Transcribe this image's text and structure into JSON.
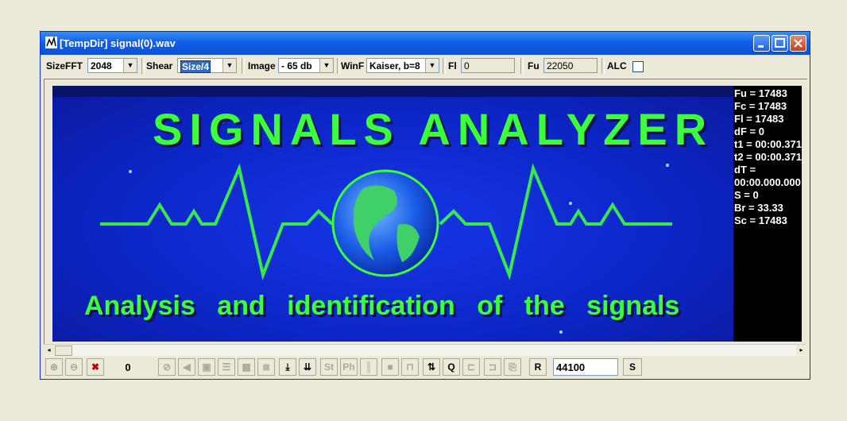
{
  "window": {
    "title": "[TempDir] signal(0).wav"
  },
  "toolbar": {
    "sizefft_label": "SizeFFT",
    "sizefft_value": "2048",
    "shear_label": "Shear",
    "shear_value": "Size/4",
    "image_label": "Image",
    "image_value": "- 65 db",
    "winf_label": "WinF",
    "winf_value": "Kaiser, b=8",
    "fl_label": "Fl",
    "fl_value": "0",
    "fu_label": "Fu",
    "fu_value": "22050",
    "alc_label": "ALC"
  },
  "spectrogram": {
    "heading": "SIGNALS ANALYZER",
    "subtitle": "Analysis and identification of the signals",
    "colors": {
      "background": "#0d26c8",
      "text": "#3cff3c",
      "line": "#3cff3c"
    }
  },
  "stats": [
    "Fu = 17483",
    "Fc = 17483",
    "Fl = 17483",
    "dF = 0",
    "t1 = 00:00.371",
    "t2 = 00:00.371",
    "dT = 00:00.000.000",
    "S = 0",
    "Br = 33.33",
    "Sc = 17483"
  ],
  "bottom": {
    "counter": "0",
    "st_label": "St",
    "ph_label": "Ph",
    "r_label": "R",
    "sample_rate": "44100",
    "s_label": "S"
  }
}
